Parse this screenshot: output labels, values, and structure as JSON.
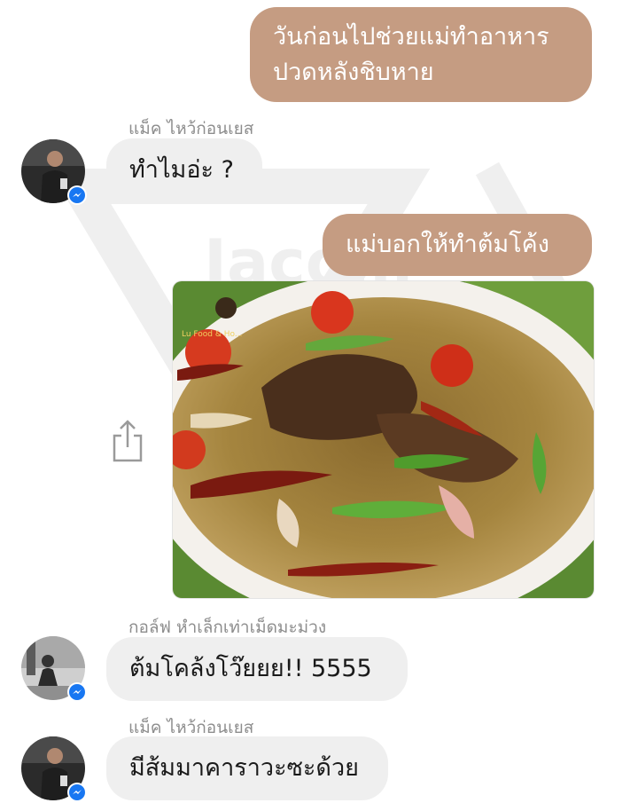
{
  "messages": {
    "m1_out": "วันก่อนไปช่วยแม่ทำอาหาร\nปวดหลังชิบหาย",
    "m2_sender": "แม็ค ไหว้ก่อนเยส",
    "m2_text": "ทำไมอ่ะ ?",
    "m3_out": "แม่บอกให้ทำต้มโค้ง",
    "m5_sender": "กอล์ฟ หำเล็กเท่าเม็ดมะม่วง",
    "m5_text": "ต้มโคล้งโว๊ยยย!! 5555",
    "m6_sender": "แม็ค ไหว้ก่อนเยส",
    "m6_text": "มีส้มมาคาราวะซะด้วย"
  },
  "image": {
    "watermark_caption": "Lu Food & Ho..."
  },
  "colors": {
    "outgoing_bubble": "#c59c82",
    "incoming_bubble": "#efefef",
    "sender_text": "#8d8d8d",
    "messenger_badge": "#1877f2"
  },
  "icons": {
    "share": "share-icon",
    "messenger": "messenger-badge-icon"
  }
}
